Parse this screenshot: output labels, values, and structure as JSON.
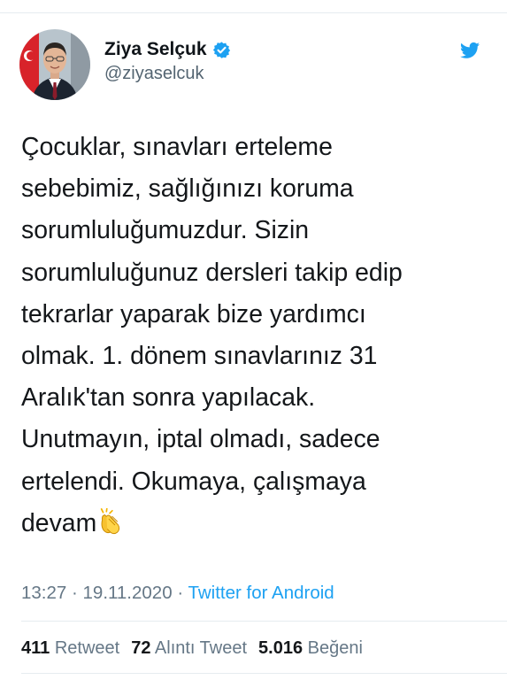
{
  "author": {
    "name": "Ziya Selçuk",
    "handle": "@ziyaselcuk",
    "verified_icon": "verified-badge-icon",
    "avatar_icon": "profile-photo"
  },
  "brand": {
    "icon": "twitter-bird-icon",
    "color": "#1da1f2"
  },
  "tweet": {
    "lines": [
      "Çocuklar, sınavları erteleme",
      "sebebimiz, sağlığınızı koruma",
      "sorumluluğumuzdur. Sizin",
      "sorumluluğunuz dersleri takip edip",
      "tekrarlar yaparak bize yardımcı",
      "olmak. 1. dönem sınavlarınız 31",
      "Aralık'tan sonra yapılacak.",
      "Unutmayın, iptal olmadı, sadece",
      "ertelendi. Okumaya, çalışmaya",
      "devam"
    ],
    "emoji": "clapping-hands-icon"
  },
  "meta": {
    "time": "13:27",
    "separator": " · ",
    "date": "19.11.2020",
    "source": "Twitter for Android"
  },
  "stats": {
    "retweets": {
      "count": "411",
      "label": "Retweet"
    },
    "quotes": {
      "count": "72",
      "label": "Alıntı Tweet"
    },
    "likes": {
      "count": "5.016",
      "label": "Beğeni"
    }
  }
}
